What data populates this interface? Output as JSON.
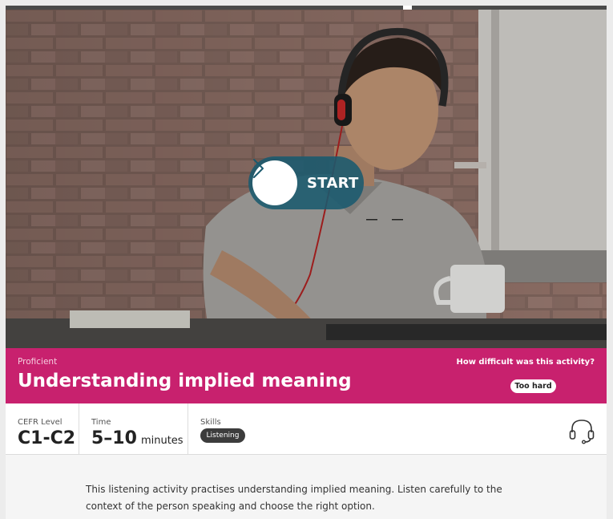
{
  "hero": {
    "start_label": "START",
    "start_icon": "chevron-right-icon"
  },
  "activity": {
    "level_name": "Proficient",
    "title": "Understanding implied meaning",
    "difficulty_question": "How difficult was this activity?",
    "difficulty_answer": "Too hard"
  },
  "info": {
    "cefr_label": "CEFR Level",
    "cefr_value": "C1-C2",
    "time_label": "Time",
    "time_value": "5–10",
    "time_unit": "minutes",
    "skills_label": "Skills",
    "skills": [
      "Listening"
    ],
    "skill_icon": "headset-icon"
  },
  "description": "This listening activity practises understanding implied meaning. Listen carefully to the context of the person speaking and choose the right option.",
  "colors": {
    "banner": "#c8216e",
    "start_button": "#1a5a6e",
    "badge": "#3c3c3c"
  }
}
